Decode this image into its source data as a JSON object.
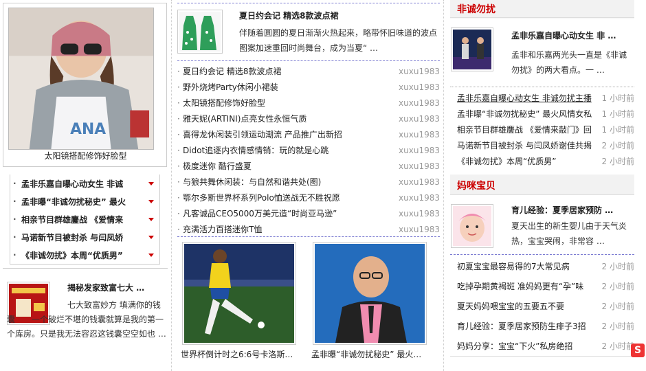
{
  "left": {
    "feature_caption": "太阳镜搭配修饰好脸型",
    "list": [
      "孟非乐嘉自曝心动女生 非诚",
      "孟非曝“非诚勿扰秘史” 最火",
      "相亲节目群雄鏖战 《爱情来",
      "马诺新节目被封杀 与闫凤娇",
      "《非诚勿扰》本周“优质男”"
    ],
    "bottom": {
      "title": "揭秘发家致富七大 …",
      "desc": "七大致富妙方 填满你的钱囊　　一个破烂不堪的钱囊就算是我的第一个库房。只是我无法容忍这钱囊空空如也 …"
    }
  },
  "middle": {
    "top": {
      "title": "夏日约会记 精选8款波点裙",
      "desc": "伴随着圆圆的夏日渐渐火热起来，略带怀旧味道的波点图案加速重回时尚舞台，成为当夏“ …"
    },
    "list": [
      {
        "title": "夏日约会记 精选8款波点裙",
        "author": "xuxu1983"
      },
      {
        "title": "野外烧烤Party休闲小裙装",
        "author": "xuxu1983"
      },
      {
        "title": "太阳镜搭配修饰好脸型",
        "author": "xuxu1983"
      },
      {
        "title": "雅天妮(ARTINI)点亮女性永恒气质",
        "author": "xuxu1983"
      },
      {
        "title": "喜得龙休闲装引领运动潮流 产品推广出新招",
        "author": "xuxu1983"
      },
      {
        "title": "Didot追逐内衣情感情销：玩的就是心跳",
        "author": "xuxu1983"
      },
      {
        "title": "极度迷你 酷行盛夏",
        "author": "xuxu1983"
      },
      {
        "title": "与狼共舞休闲装：与自然和谐共处(图)",
        "author": "xuxu1983"
      },
      {
        "title": "鄂尔多斯世界杯系列Polo恤送战无不胜祝愿",
        "author": "xuxu1983"
      },
      {
        "title": "凡客诚品CEO5000万美元造“时尚亚马逊”",
        "author": "xuxu1983"
      },
      {
        "title": "充满活力百搭迷你T恤",
        "author": "xuxu1983"
      }
    ],
    "photos": [
      {
        "caption": "世界杯倒计时之6:6号卡洛斯…"
      },
      {
        "caption": "孟非曝“非诚勿扰秘史” 最火…"
      }
    ]
  },
  "right": {
    "sec1": {
      "head": "非诚勿扰",
      "title": "孟非乐嘉自曝心动女生 非 …",
      "desc": "孟非和乐嘉两光头一直是《非诚勿扰》的两大看点。一 …",
      "list": [
        {
          "title": "孟非乐嘉自曝心动女生 非诚勿扰主播",
          "time": "1 小时前"
        },
        {
          "title": "孟非曝“非诚勿扰秘史” 最火风情女私",
          "time": "1 小时前"
        },
        {
          "title": "相亲节目群雄鏖战 《爱情来敲门》回",
          "time": "1 小时前"
        },
        {
          "title": "马诺新节目被封杀 与闫凤娇谢佳共揭",
          "time": "2 小时前"
        },
        {
          "title": "《非诚勿扰》本周“优质男”",
          "time": "2 小时前"
        }
      ]
    },
    "sec2": {
      "head": "妈咪宝贝",
      "title": "育儿经验：夏季居家预防 …",
      "desc": "夏天出生的新生婴儿由于天气炎热，宝宝哭闹，非常容 …",
      "list": [
        {
          "title": "初夏宝宝最容易得的7大常见病",
          "time": "2 小时前"
        },
        {
          "title": "吃掉孕期黄褐斑 准妈妈更有“孕”味",
          "time": "2 小时前"
        },
        {
          "title": "夏天妈妈喂宝宝的五要五不要",
          "time": "2 小时前"
        },
        {
          "title": "育儿经验：夏季居家预防生痱子3招",
          "time": "2 小时前"
        },
        {
          "title": "妈妈分享：宝宝“下火”私房绝招",
          "time": "2 小时前"
        }
      ]
    }
  },
  "icons": {
    "sohu": "S"
  },
  "colors": {
    "accent": "#cc0000",
    "dash": "#7b7bd1",
    "muted": "#999999"
  }
}
